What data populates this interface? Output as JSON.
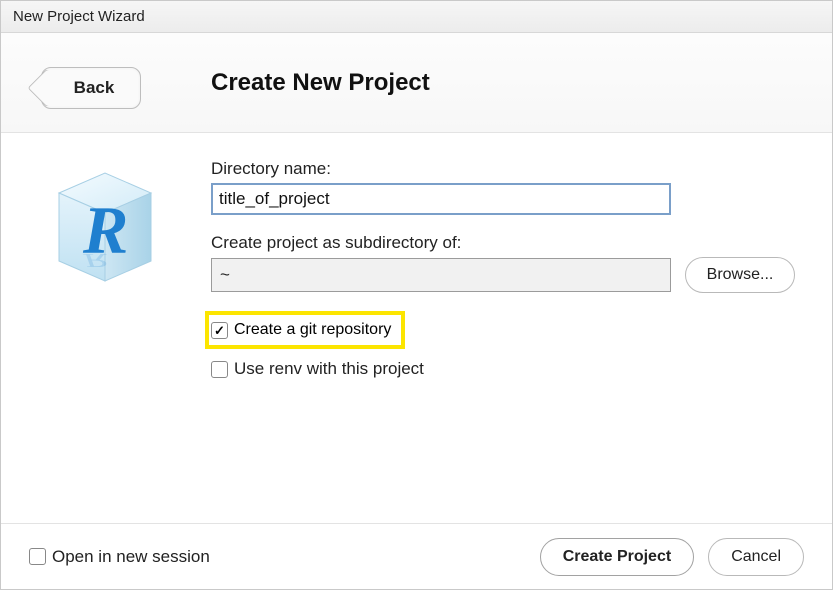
{
  "window": {
    "title": "New Project Wizard"
  },
  "header": {
    "back_label": "Back",
    "title": "Create New Project"
  },
  "form": {
    "dir_label": "Directory name:",
    "dir_value": "title_of_project",
    "subdir_label": "Create project as subdirectory of:",
    "subdir_value": "~",
    "browse_label": "Browse...",
    "git_label": "Create a git repository",
    "git_checked": true,
    "renv_label": "Use renv with this project",
    "renv_checked": false
  },
  "footer": {
    "open_session_label": "Open in new session",
    "open_session_checked": false,
    "create_label": "Create Project",
    "cancel_label": "Cancel"
  },
  "icons": {
    "logo": "r-logo"
  }
}
